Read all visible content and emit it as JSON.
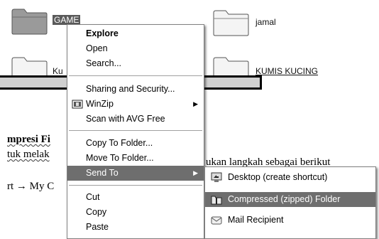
{
  "desktop": {
    "folders": [
      {
        "name": "GAME",
        "selected": true
      },
      {
        "name": "jamal"
      },
      {
        "name": "Ku"
      },
      {
        "name": "KUMIS KUCING"
      }
    ]
  },
  "document": {
    "heading_fragment": "mpresi Fi",
    "line1_left": "tuk melak",
    "line1_right": "ukan langkah sebagai berikut",
    "line2_left": "rt → My C"
  },
  "context_menu": {
    "items": [
      {
        "label": "Explore",
        "bold": true
      },
      {
        "label": "Open"
      },
      {
        "label": "Search..."
      },
      {
        "label": "Sharing and Security..."
      },
      {
        "label": "WinZip",
        "icon": "winzip-icon",
        "submenu": true
      },
      {
        "label": "Scan with AVG Free"
      },
      {
        "label": "Copy To Folder..."
      },
      {
        "label": "Move To Folder..."
      },
      {
        "label": "Send To",
        "highlighted": true,
        "submenu": true
      },
      {
        "label": "Cut"
      },
      {
        "label": "Copy"
      },
      {
        "label": "Paste"
      }
    ]
  },
  "send_to_menu": {
    "items": [
      {
        "label": "Desktop (create shortcut)",
        "icon": "desktop-shortcut-icon"
      },
      {
        "label": "Compressed (zipped) Folder",
        "icon": "zip-folder-icon",
        "highlighted": true
      },
      {
        "label": "Mail Recipient",
        "icon": "mail-icon"
      }
    ]
  },
  "colors": {
    "highlight": "#6e6e6e",
    "menu_border": "#808080"
  }
}
